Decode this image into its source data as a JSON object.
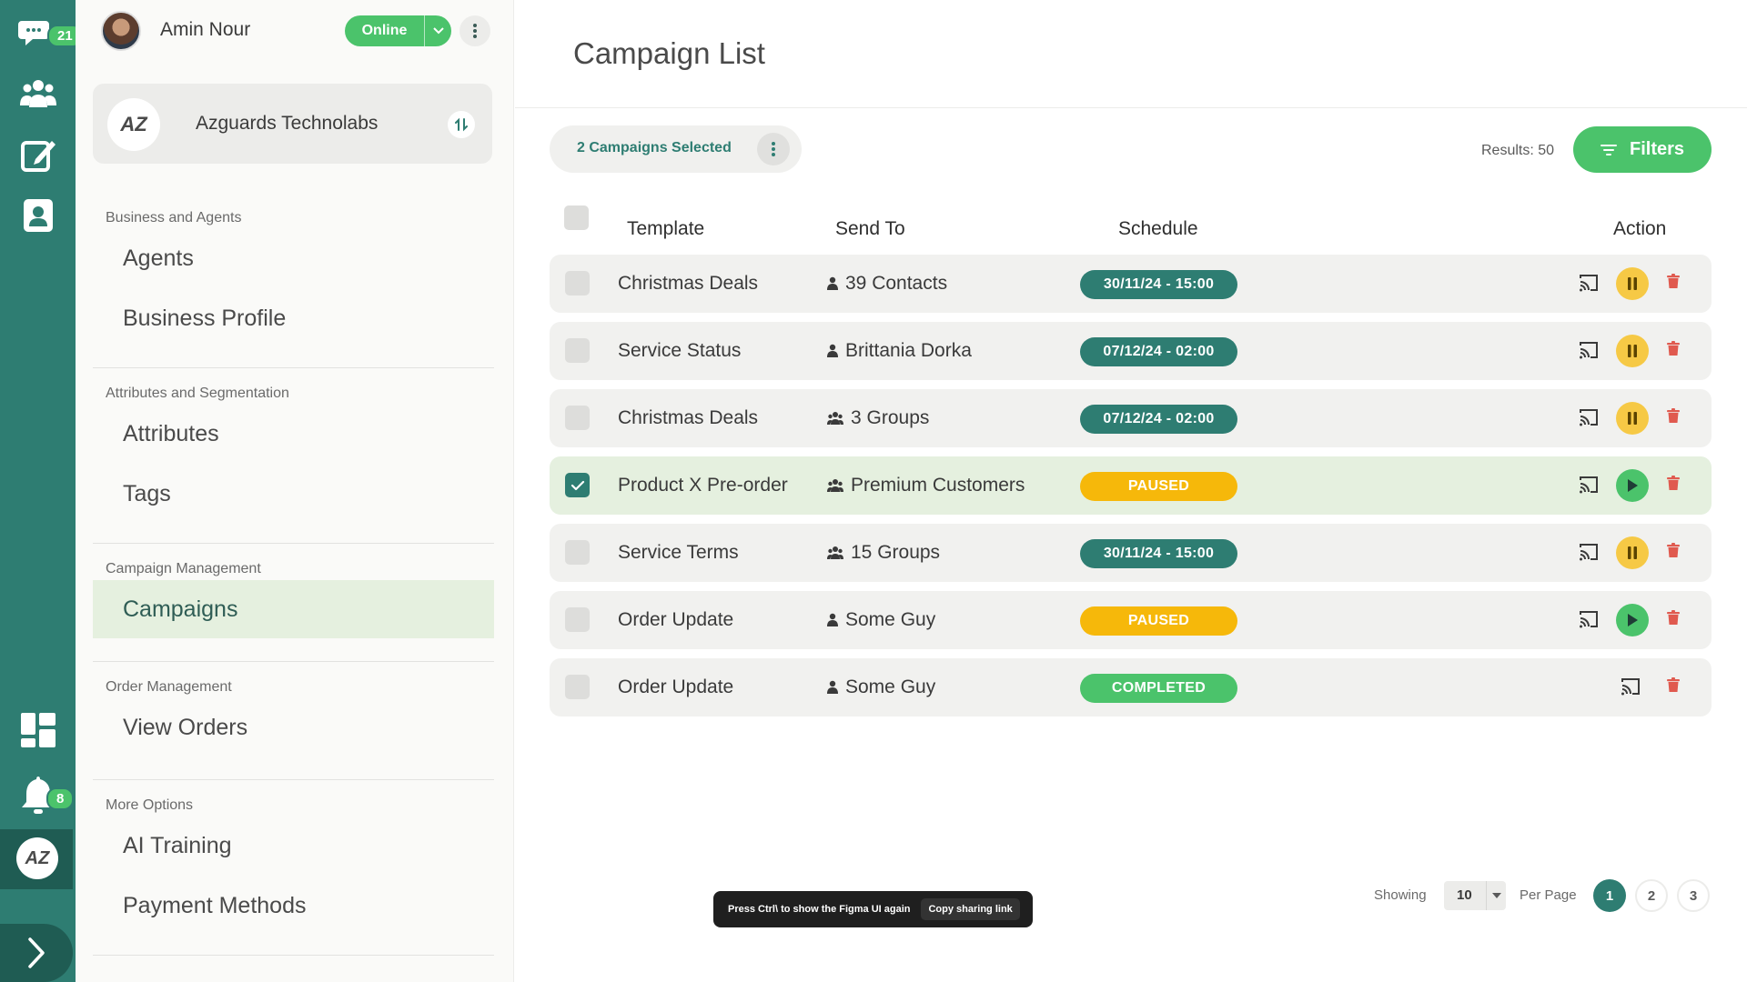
{
  "rail": {
    "chat_badge": "21",
    "notifications_badge": "8",
    "icons": [
      "chat-icon",
      "contacts-icon",
      "compose-icon",
      "contact-card-icon",
      "dashboard-icon",
      "bell-icon"
    ],
    "avatar_logo": "AZ"
  },
  "user": {
    "name": "Amin Nour",
    "status": "Online"
  },
  "business": {
    "name": "Azguards Technolabs",
    "logo": "AZ"
  },
  "nav": {
    "sections": [
      {
        "heading": "Business and Agents",
        "items": [
          "Agents",
          "Business Profile"
        ]
      },
      {
        "heading": "Attributes and Segmentation",
        "items": [
          "Attributes",
          "Tags"
        ]
      },
      {
        "heading": "Campaign Management",
        "items": [
          "Campaigns"
        ]
      },
      {
        "heading": "Order Management",
        "items": [
          "View Orders"
        ]
      },
      {
        "heading": "More Options",
        "items": [
          "AI Training",
          "Payment Methods"
        ]
      }
    ],
    "active_item": "Campaigns"
  },
  "page": {
    "title": "Campaign List",
    "selected_label": "2 Campaigns Selected",
    "results": "Results: 50",
    "filters_label": "Filters"
  },
  "table": {
    "columns": [
      "Template",
      "Send To",
      "Schedule",
      "Action"
    ],
    "rows": [
      {
        "template": "Christmas Deals",
        "send_to": "39 Contacts",
        "recipient_type": "person",
        "schedule": "30/11/24 - 15:00",
        "state": "scheduled",
        "control": "pause",
        "checked": false
      },
      {
        "template": "Service Status",
        "send_to": "Brittania Dorka",
        "recipient_type": "person",
        "schedule": "07/12/24 - 02:00",
        "state": "scheduled",
        "control": "pause",
        "checked": false
      },
      {
        "template": "Christmas Deals",
        "send_to": "3 Groups",
        "recipient_type": "group",
        "schedule": "07/12/24 - 02:00",
        "state": "scheduled",
        "control": "pause",
        "checked": false
      },
      {
        "template": "Product X Pre-order",
        "send_to": "Premium Customers",
        "recipient_type": "group",
        "schedule": "PAUSED",
        "state": "paused",
        "control": "play",
        "checked": true
      },
      {
        "template": "Service Terms",
        "send_to": "15 Groups",
        "recipient_type": "group",
        "schedule": "30/11/24 - 15:00",
        "state": "scheduled",
        "control": "pause",
        "checked": false
      },
      {
        "template": "Order Update",
        "send_to": "Some Guy",
        "recipient_type": "person",
        "schedule": "PAUSED",
        "state": "paused",
        "control": "play",
        "checked": false
      },
      {
        "template": "Order Update",
        "send_to": "Some Guy",
        "recipient_type": "person",
        "schedule": "COMPLETED",
        "state": "completed",
        "control": "none",
        "checked": false
      }
    ]
  },
  "pagination": {
    "showing_label": "Showing",
    "per_page_value": "10",
    "per_page_label": "Per Page",
    "pages": [
      "1",
      "2",
      "3"
    ],
    "current": "1"
  },
  "toast": {
    "message": "Press Ctrl\\ to show the Figma UI again",
    "action": "Copy sharing link"
  },
  "colors": {
    "primary": "#2e7d72",
    "accent_green": "#4bc36b",
    "paused": "#f6b80a",
    "pause_button": "#f6c945",
    "delete": "#e05a4f",
    "selected_row": "#e5f0df"
  }
}
